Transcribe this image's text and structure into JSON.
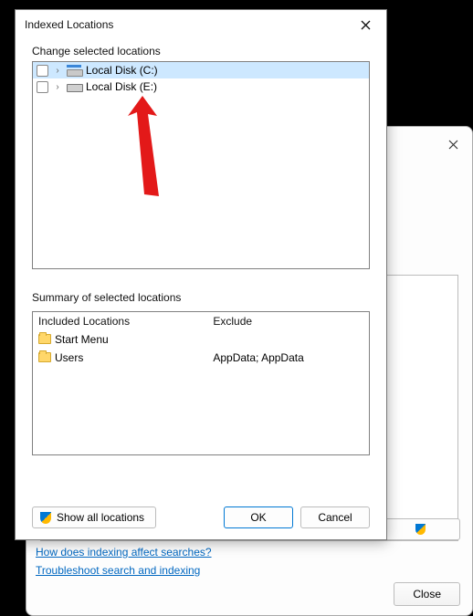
{
  "bgWindow": {
    "closeButton": "Close",
    "links": {
      "affect": "How does indexing affect searches?",
      "troubleshoot": "Troubleshoot search and indexing"
    }
  },
  "dialog": {
    "title": "Indexed Locations",
    "changeLabel": "Change selected locations",
    "tree": [
      {
        "label": "Local Disk (C:)",
        "selected": true,
        "iconClass": "c"
      },
      {
        "label": "Local Disk (E:)",
        "selected": false,
        "iconClass": "e"
      }
    ],
    "summaryLabel": "Summary of selected locations",
    "summaryHead": {
      "included": "Included Locations",
      "exclude": "Exclude"
    },
    "summaryRows": [
      {
        "included": "Start Menu",
        "exclude": ""
      },
      {
        "included": "Users",
        "exclude": "AppData; AppData"
      }
    ],
    "showAll": "Show all locations",
    "ok": "OK",
    "cancel": "Cancel"
  }
}
